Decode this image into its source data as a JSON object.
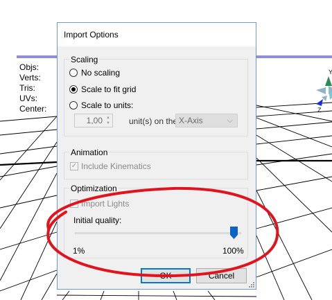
{
  "viewport": {
    "info_labels": [
      "Objs:",
      "Verts:",
      "Tris:",
      "UVs:",
      "Center:"
    ],
    "gizmo_axes": {
      "y": "Y",
      "z": "Z"
    }
  },
  "dialog": {
    "title": "Import Options",
    "scaling": {
      "title": "Scaling",
      "options": [
        {
          "label": "No scaling",
          "checked": false
        },
        {
          "label": "Scale to fit grid",
          "checked": true
        },
        {
          "label": "Scale to units:",
          "checked": false
        }
      ],
      "units_value": "1,00",
      "units_label": "unit(s) on the",
      "axis_value": "X-Axis"
    },
    "animation": {
      "title": "Animation",
      "include_kinematics_label": "Include Kinematics",
      "include_kinematics_checked": true
    },
    "optimization": {
      "title": "Optimization",
      "import_lights_label": "Import Lights",
      "initial_quality_label": "Initial quality:",
      "quality_value_fraction": 1.0,
      "min_label": "1%",
      "max_label": "100%"
    },
    "buttons": {
      "ok": "OK",
      "cancel": "Cancel"
    }
  },
  "annotation": {
    "color": "#e0141e"
  }
}
